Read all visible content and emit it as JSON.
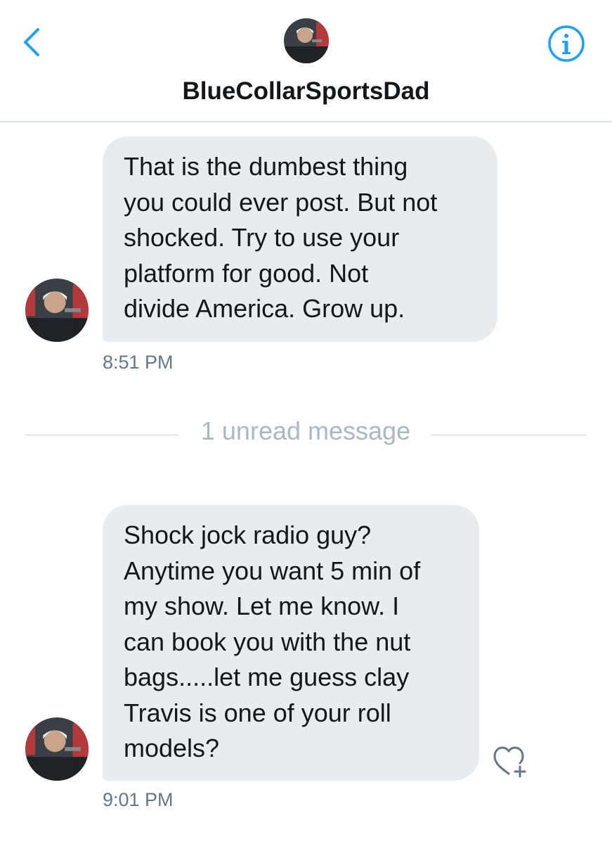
{
  "header": {
    "title": "BlueCollarSportsDad",
    "back_icon": "chevron-left-icon",
    "info_icon": "info-circle-icon"
  },
  "messages": [
    {
      "lines": [
        "That is the dumbest thing",
        "you could ever post. But not",
        "shocked. Try to use your",
        "platform for good. Not",
        "divide America. Grow up."
      ],
      "time": "8:51 PM"
    },
    {
      "lines": [
        "Shock jock radio guy?",
        "Anytime you want 5 min of",
        "my show. Let me know. I",
        "can book you with the nut",
        "bags.....let me guess clay",
        "Travis is one of your roll",
        "models?"
      ],
      "time": "9:01 PM"
    }
  ],
  "divider": {
    "label": "1 unread message"
  },
  "actions": {
    "like_icon": "heart-plus-icon"
  },
  "colors": {
    "accent": "#1da1f2",
    "bubble": "#e6ecf0",
    "text": "#14171a",
    "secondary_text": "#657786",
    "divider_text": "#aab8c2"
  }
}
